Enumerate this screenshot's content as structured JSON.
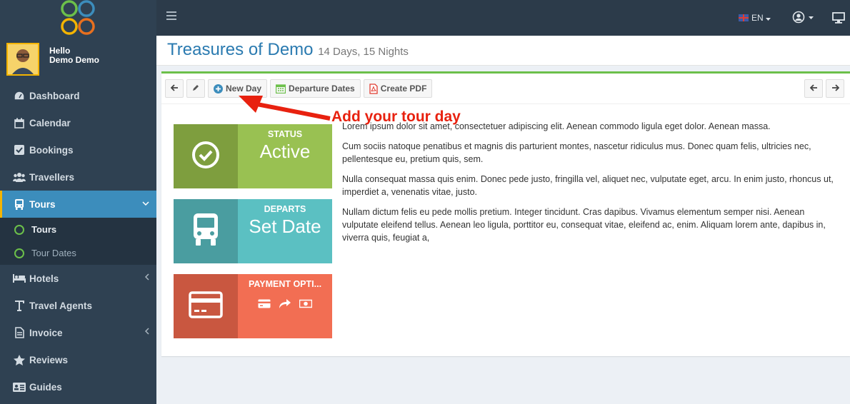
{
  "sidebar": {
    "greeting": "Hello",
    "user_name": "Demo Demo",
    "items": [
      {
        "label": "Dashboard",
        "icon": "dashboard-icon"
      },
      {
        "label": "Calendar",
        "icon": "calendar-icon"
      },
      {
        "label": "Bookings",
        "icon": "check-square-icon"
      },
      {
        "label": "Travellers",
        "icon": "users-icon"
      },
      {
        "label": "Tours",
        "icon": "bus-icon",
        "active": true
      },
      {
        "label": "Hotels",
        "icon": "bed-icon"
      },
      {
        "label": "Travel Agents",
        "icon": "text-icon"
      },
      {
        "label": "Invoice",
        "icon": "file-icon"
      },
      {
        "label": "Reviews",
        "icon": "star-icon"
      },
      {
        "label": "Guides",
        "icon": "id-card-icon"
      }
    ],
    "sub_items": [
      {
        "label": "Tours"
      },
      {
        "label": "Tour Dates"
      }
    ]
  },
  "topbar": {
    "language": "EN"
  },
  "page": {
    "title": "Treasures of Demo",
    "subtitle": "14 Days, 15 Nights"
  },
  "toolbar": {
    "new_day": "New Day",
    "departure_dates": "Departure Dates",
    "create_pdf": "Create PDF"
  },
  "cards": [
    {
      "label": "STATUS",
      "value": "Active",
      "color_left": "#7e9e3e",
      "color_right": "#99c152"
    },
    {
      "label": "DEPARTS",
      "value": "Set Date",
      "color_left": "#4a9da0",
      "color_right": "#5bc0c2"
    },
    {
      "label": "PAYMENT OPTI...",
      "value": "",
      "color_left": "#c95740",
      "color_right": "#f26e53"
    }
  ],
  "content": {
    "p1": "Lorem ipsum dolor sit amet, consectetuer adipiscing elit. Aenean commodo ligula eget dolor. Aenean massa.",
    "p2": "Cum sociis natoque penatibus et magnis dis parturient montes, nascetur ridiculus mus. Donec quam felis, ultricies nec, pellentesque eu, pretium quis, sem.",
    "p3": "Nulla consequat massa quis enim. Donec pede justo, fringilla vel, aliquet nec, vulputate eget, arcu. In enim justo, rhoncus ut, imperdiet a, venenatis vitae, justo.",
    "p4": "Nullam dictum felis eu pede mollis pretium. Integer tincidunt. Cras dapibus. Vivamus elementum semper nisi. Aenean vulputate eleifend tellus. Aenean leo ligula, porttitor eu, consequat vitae, eleifend ac, enim. Aliquam lorem ante, dapibus in, viverra quis, feugiat a,"
  },
  "annotation": "Add your tour day",
  "colors": {
    "accent": "#3c8dbc",
    "success": "#6cc04a",
    "annotation": "#e8210f"
  }
}
